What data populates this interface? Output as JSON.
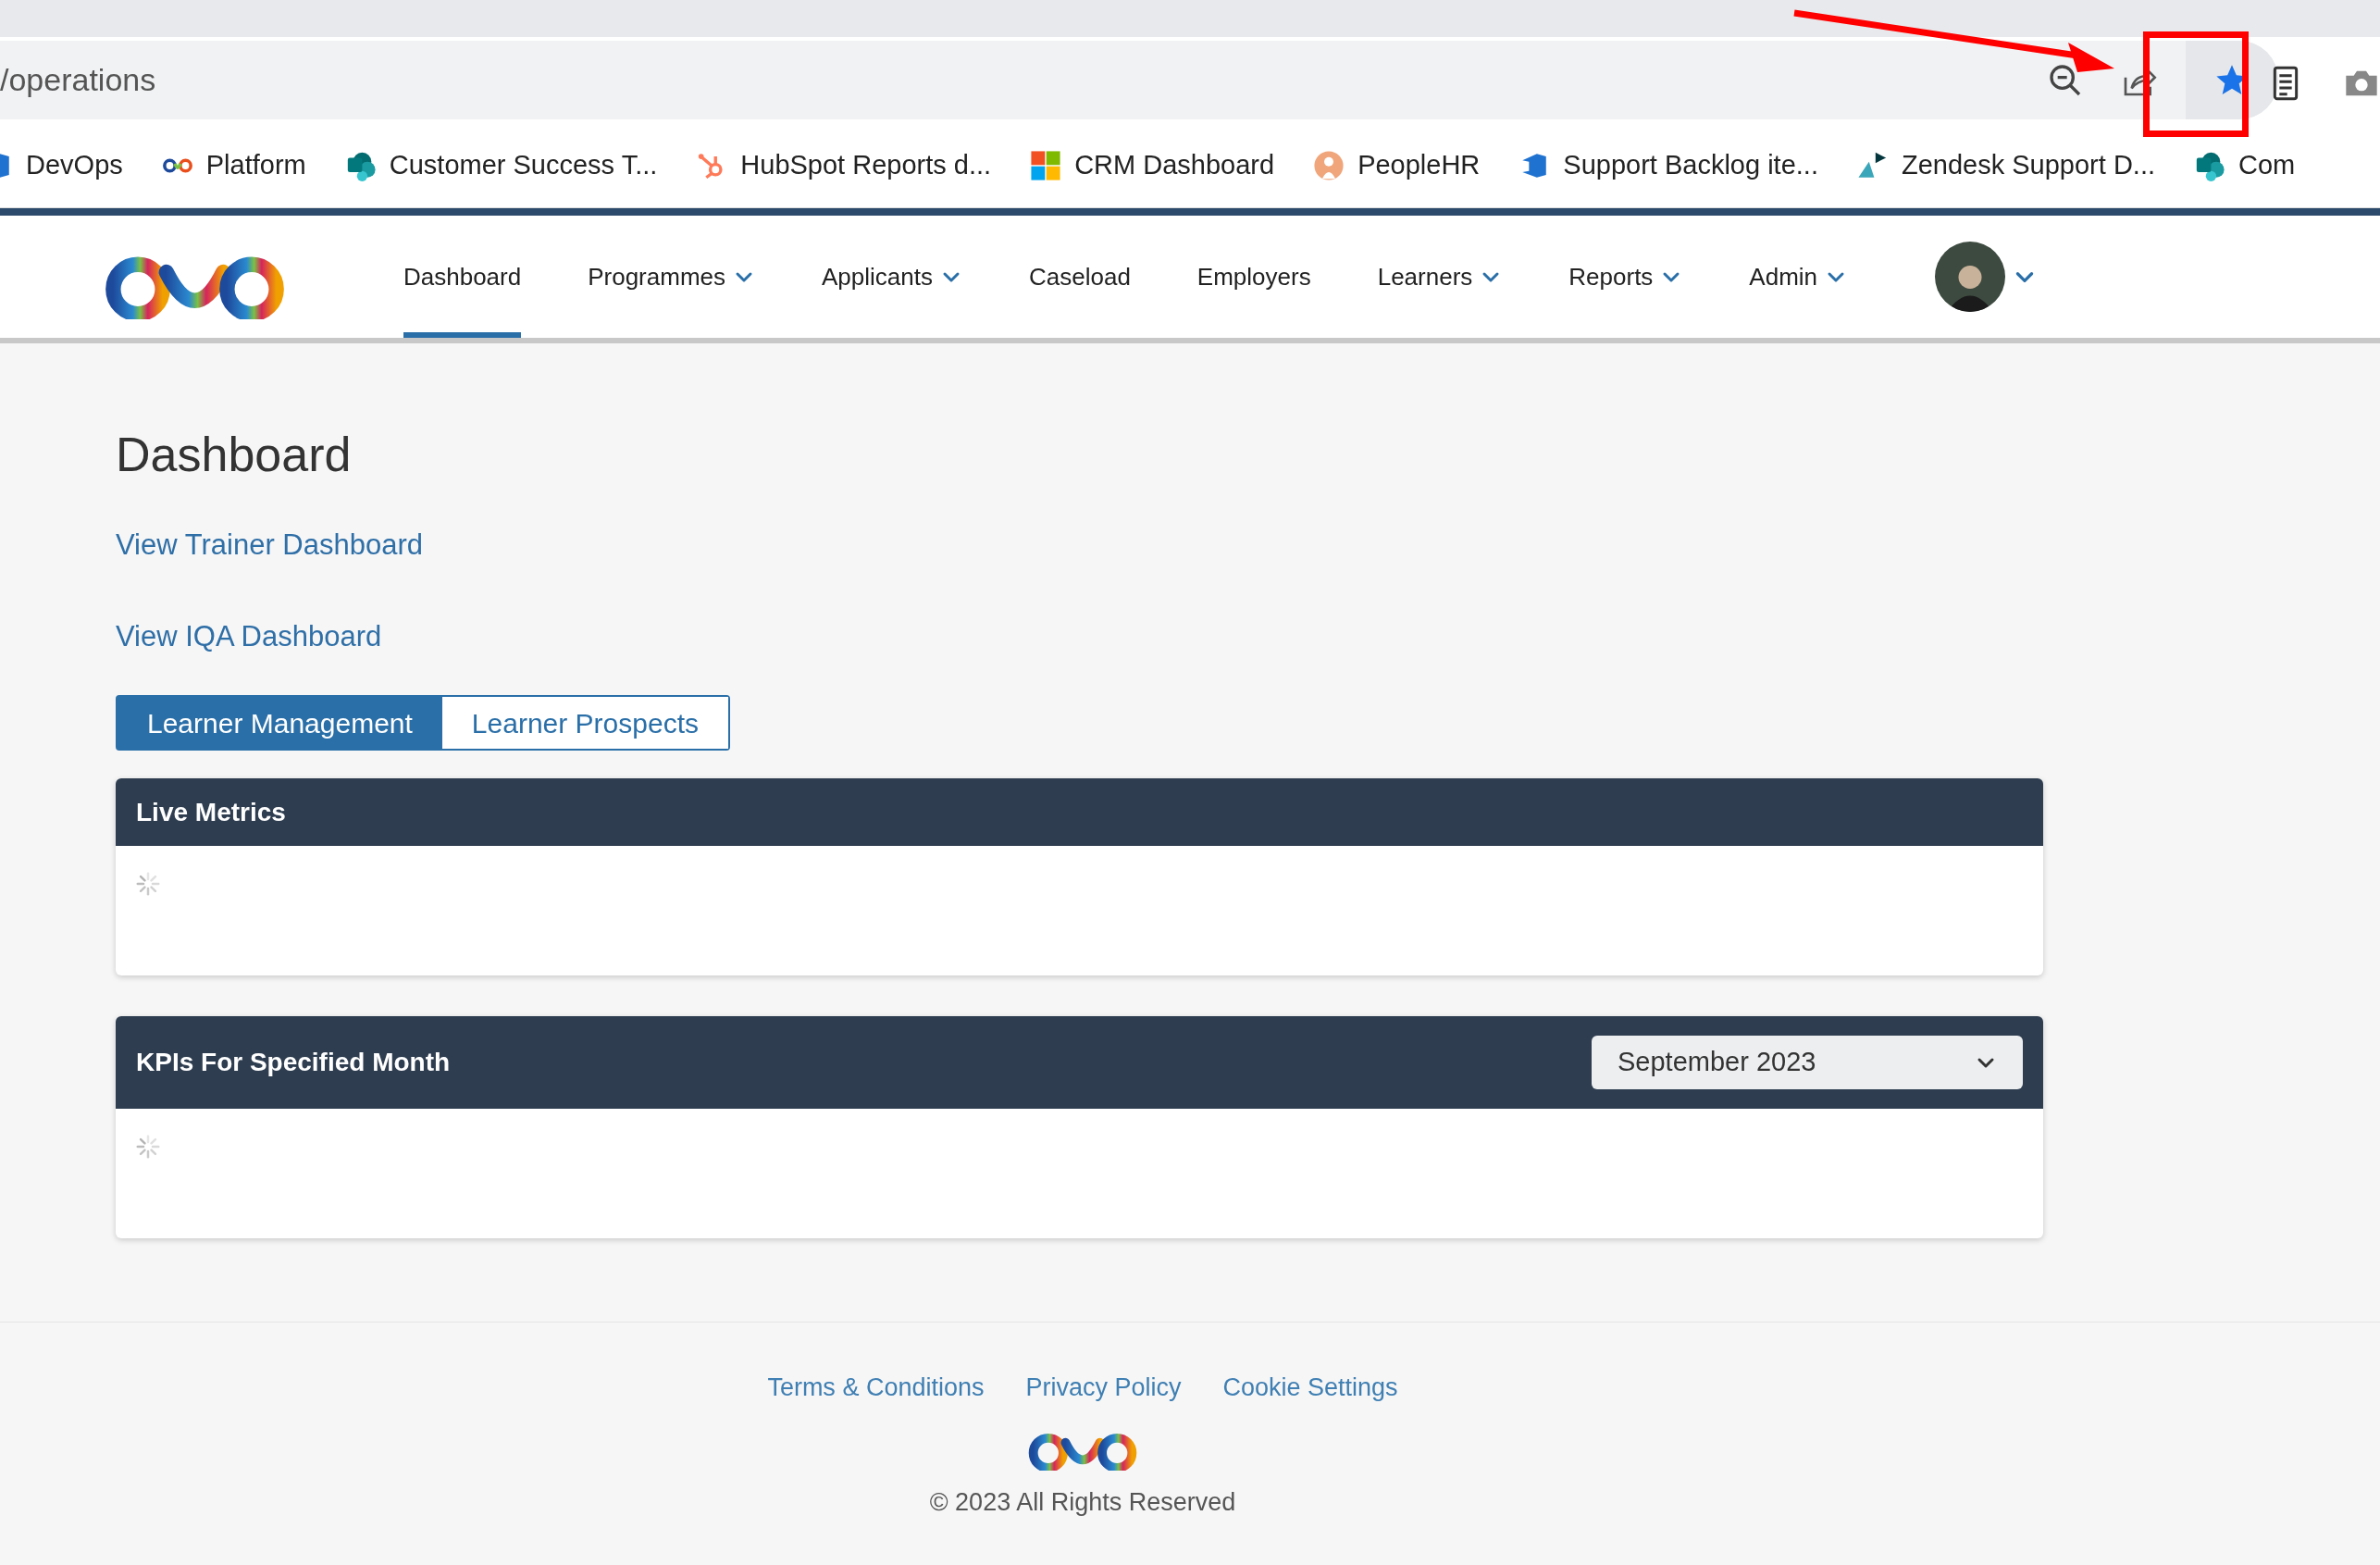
{
  "browser": {
    "address": "/operations",
    "bookmarks": [
      {
        "kind": "devops",
        "label": "DevOps"
      },
      {
        "kind": "bud",
        "label": "Platform"
      },
      {
        "kind": "sharepoint",
        "label": "Customer Success T..."
      },
      {
        "kind": "hubspot",
        "label": "HubSpot Reports d..."
      },
      {
        "kind": "windows",
        "label": "CRM Dashboard"
      },
      {
        "kind": "peoplehr",
        "label": "PeopleHR"
      },
      {
        "kind": "devops",
        "label": "Support Backlog ite..."
      },
      {
        "kind": "zendesk",
        "label": "Zendesk Support D..."
      },
      {
        "kind": "sharepoint",
        "label": "Com"
      }
    ]
  },
  "nav": {
    "items": [
      {
        "label": "Dashboard",
        "selected": true,
        "dropdown": false
      },
      {
        "label": "Programmes",
        "selected": false,
        "dropdown": true
      },
      {
        "label": "Applicants",
        "selected": false,
        "dropdown": true
      },
      {
        "label": "Caseload",
        "selected": false,
        "dropdown": false
      },
      {
        "label": "Employers",
        "selected": false,
        "dropdown": false
      },
      {
        "label": "Learners",
        "selected": false,
        "dropdown": true
      },
      {
        "label": "Reports",
        "selected": false,
        "dropdown": true
      },
      {
        "label": "Admin",
        "selected": false,
        "dropdown": true
      }
    ]
  },
  "page": {
    "title": "Dashboard",
    "links": [
      "View Trainer Dashboard",
      "View IQA Dashboard"
    ],
    "tabs": [
      {
        "label": "Learner Management",
        "selected": true
      },
      {
        "label": "Learner Prospects",
        "selected": false
      }
    ]
  },
  "panels": [
    {
      "title": "Live Metrics",
      "loading": true
    },
    {
      "title": "KPIs For Specified Month",
      "loading": true,
      "select": "September 2023"
    }
  ],
  "footer": {
    "links": [
      "Terms & Conditions",
      "Privacy Policy",
      "Cookie Settings"
    ],
    "copyright": "© 2023 All Rights Reserved"
  }
}
